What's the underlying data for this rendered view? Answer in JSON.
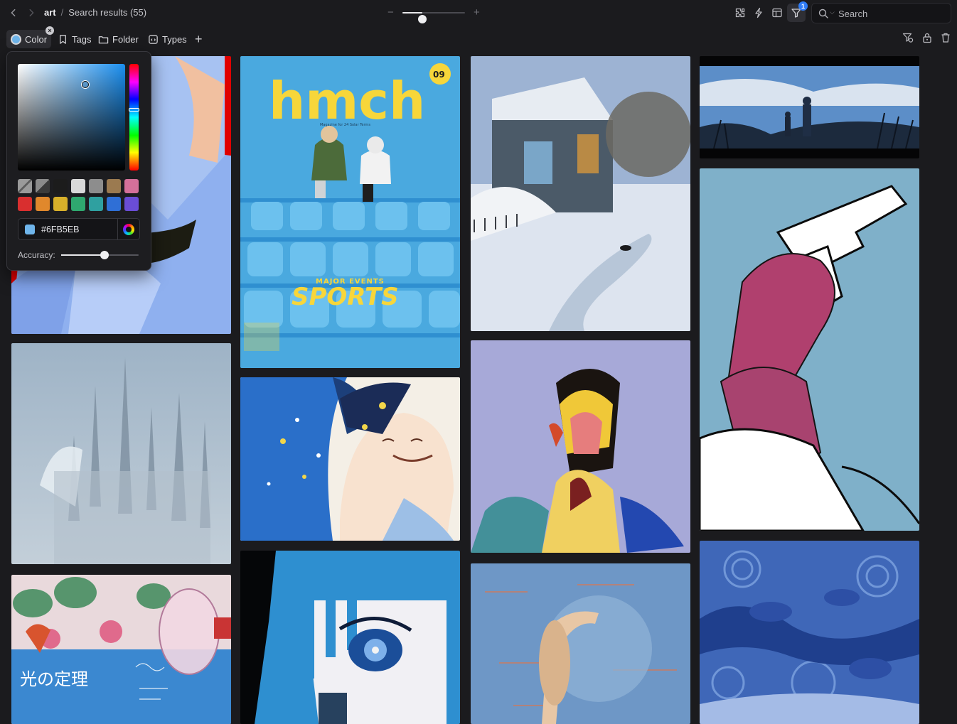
{
  "breadcrumb": {
    "root": "art",
    "separator": "/",
    "current": "Search results (55)"
  },
  "zoom": {
    "minus_symbol": "−",
    "plus_symbol": "+",
    "level": 0.32
  },
  "toolbar": {
    "filter_badge": "1"
  },
  "search": {
    "placeholder": "Search",
    "value": ""
  },
  "filters": {
    "color_label": "Color",
    "tags_label": "Tags",
    "folder_label": "Folder",
    "types_label": "Types",
    "add_symbol": "+",
    "clear_symbol": "×"
  },
  "color_picker": {
    "hex": "#6FB5EB",
    "selected_color": "#6FB5EB",
    "accuracy_label": "Accuracy:",
    "accuracy": 0.56,
    "swatches": [
      "#8a8a8a",
      "#5e5e5e",
      "#1c1c1c",
      "#d9d9d9",
      "#8d8d8d",
      "#9b7a50",
      "#d4709a",
      "#d92f2f",
      "#e0882c",
      "#d8b02a",
      "#2fa86f",
      "#2fa0a0",
      "#2f6fd6",
      "#6a4dd6"
    ]
  },
  "gallery": {
    "images": [
      "Red and blue figure painting",
      "hmch magazine cover SPORTS",
      "Snowy village house painting",
      "Two boys in field anime still",
      "Castle in fog painting",
      "Smiling girl with stars",
      "Abstract portrait painting",
      "Hand holding pistol drawing",
      "Lightbulb collage poster",
      "Anime eye close-up",
      "Figure with moon painting",
      "Blue impasto landscape"
    ],
    "magazine_title": "hmch",
    "magazine_issue": "09",
    "magazine_subtitle": "Magazine for 24 Solar Terms",
    "magazine_major": "MAJOR EVENTS",
    "magazine_sports": "SPORTS",
    "poster_title": "光の定理"
  }
}
